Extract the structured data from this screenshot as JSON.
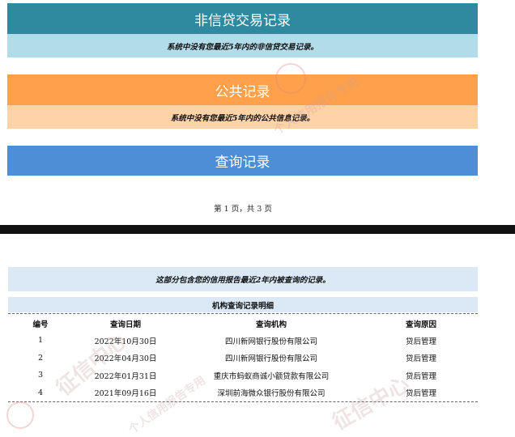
{
  "sections": {
    "non_credit": {
      "title": "非信贷交易记录",
      "note": "系统中没有您最近5年内的非信贷交易记录。"
    },
    "public": {
      "title": "公共记录",
      "note": "系统中没有您最近5年内的公共信息记录。"
    },
    "inquiry": {
      "title": "查询记录"
    }
  },
  "page_number": "第 1 页，共 3 页",
  "inquiry": {
    "intro": "这部分包含您的信用报告最近2年内被查询的记录。",
    "subtitle": "机构查询记录明细",
    "columns": [
      "编号",
      "查询日期",
      "查询机构",
      "查询原因"
    ],
    "rows": [
      [
        "1",
        "2022年10月30日",
        "四川新网银行股份有限公司",
        "贷后管理"
      ],
      [
        "2",
        "2022年04月30日",
        "四川新网银行股份有限公司",
        "贷后管理"
      ],
      [
        "3",
        "2022年01月31日",
        "重庆市蚂蚁商诚小额贷款有限公司",
        "贷后管理"
      ],
      [
        "4",
        "2021年09月16日",
        "深圳前海微众银行股份有限公司",
        "贷后管理"
      ]
    ]
  },
  "watermark": {
    "text": "征信中心",
    "subtext": "个人信用报告专用",
    "color": "#c9a0a0"
  },
  "colors": {
    "teal_header": "#2f8aa0",
    "teal_note": "#b2dcea",
    "orange_header": "#ffa04a",
    "orange_note": "#ffd3a8",
    "blue_header": "#4d8ed6",
    "blue_note": "#dbe8f6"
  }
}
